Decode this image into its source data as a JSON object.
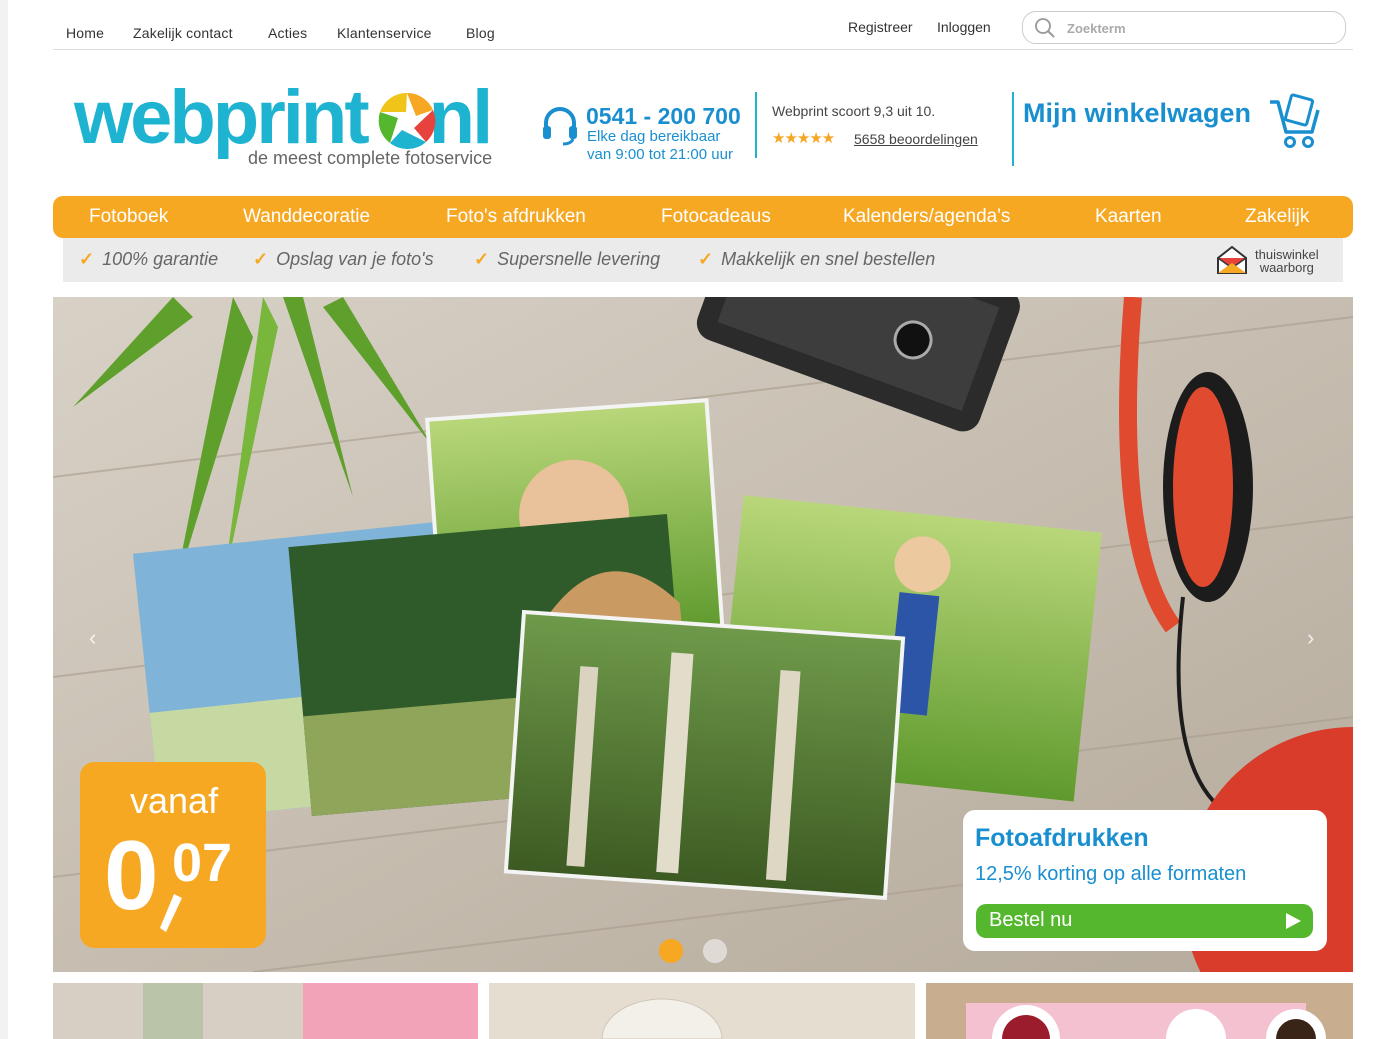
{
  "topnav": {
    "items": [
      "Home",
      "Zakelijk contact",
      "Acties",
      "Klantenservice",
      "Blog"
    ],
    "register": "Registreer",
    "login": "Inloggen"
  },
  "search": {
    "placeholder": "Zoekterm",
    "icon": "search-icon"
  },
  "header": {
    "logo_text": "webprint",
    "logo_suffix": "nl",
    "tagline": "de meest complete fotoservice",
    "phone_number": "0541 - 200 700",
    "phone_line1": "Elke dag bereikbaar",
    "phone_line2": "van 9:00 tot 21:00 uur",
    "score_text": "Webprint scoort 9,3 uit 10.",
    "stars": "★★★★★",
    "reviews": "5658 beoordelingen",
    "cart_label": "Mijn winkelwagen"
  },
  "nav": {
    "items": [
      "Fotoboek",
      "Wanddecoratie",
      "Foto's afdrukken",
      "Fotocadeaus",
      "Kalenders/agenda's",
      "Kaarten",
      "Zakelijk"
    ]
  },
  "usp": {
    "items": [
      "100% garantie",
      "Opslag van je foto's",
      "Supersnelle levering",
      "Makkelijk en snel bestellen"
    ],
    "check": "✓",
    "trust_line1": "thuiswinkel",
    "trust_line2": "waarborg"
  },
  "hero": {
    "badge_from": "vanaf",
    "badge_price_main": "0",
    "badge_price_cents": "07",
    "promo_title": "Fotoafdrukken",
    "promo_subtitle": "12,5% korting op alle formaten",
    "promo_button": "Bestel nu",
    "prev": "‹",
    "next": "›",
    "slides_total": 2,
    "active_slide": 1
  },
  "colors": {
    "accent_orange": "#f7a823",
    "brand_blue": "#1eb4d1",
    "text_blue": "#1a8fd0",
    "cta_green": "#55b72e"
  }
}
